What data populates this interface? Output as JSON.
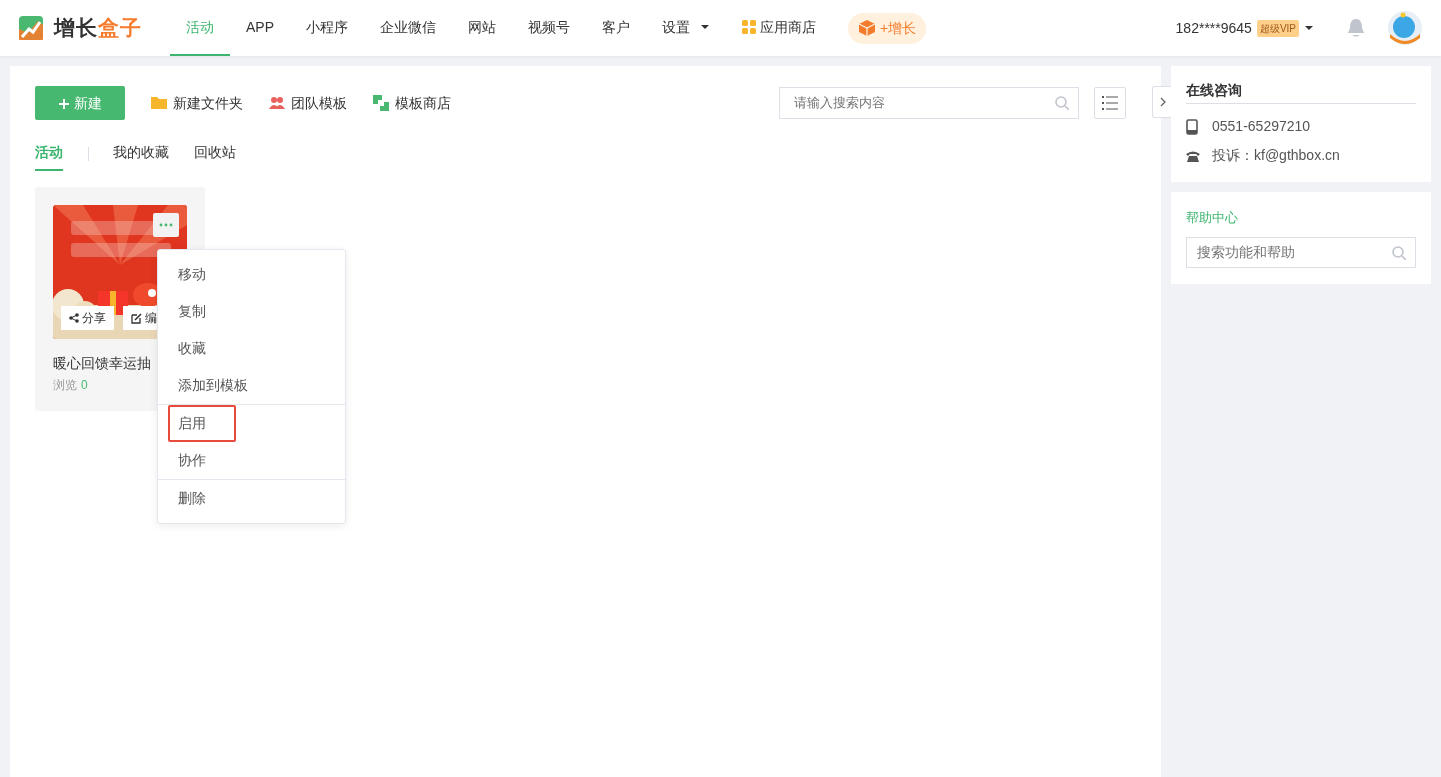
{
  "header": {
    "logo": {
      "part_a": "增长",
      "part_b": "盒子"
    },
    "nav": [
      {
        "label": "活动",
        "selected": true,
        "kind": "link"
      },
      {
        "label": "APP",
        "selected": false,
        "kind": "link"
      },
      {
        "label": "小程序",
        "selected": false,
        "kind": "link"
      },
      {
        "label": "企业微信",
        "selected": false,
        "kind": "link"
      },
      {
        "label": "网站",
        "selected": false,
        "kind": "link"
      },
      {
        "label": "视频号",
        "selected": false,
        "kind": "link"
      },
      {
        "label": "客户",
        "selected": false,
        "kind": "link"
      },
      {
        "label": "设置",
        "selected": false,
        "kind": "dropdown"
      },
      {
        "label": "应用商店",
        "selected": false,
        "kind": "store"
      }
    ],
    "growth_button": "+增长",
    "user": {
      "phone": "182****9645",
      "badge": "超级VIP"
    }
  },
  "toolbar": {
    "new_button": "新建",
    "actions": [
      {
        "label": "新建文件夹",
        "kind": "folder"
      },
      {
        "label": "团队模板",
        "kind": "team"
      },
      {
        "label": "模板商店",
        "kind": "store"
      }
    ],
    "search": {
      "placeholder": "请输入搜索内容"
    }
  },
  "tabs": [
    {
      "label": "活动",
      "selected": true
    },
    {
      "label": "我的收藏",
      "selected": false
    },
    {
      "label": "回收站",
      "selected": false
    }
  ],
  "cards": [
    {
      "kind": "picture",
      "share": "分享",
      "edit": "编",
      "title": "暖心回馈幸运抽",
      "views_label": "浏览",
      "views": "0"
    }
  ],
  "menu": {
    "groups": [
      [
        {
          "label": "移动",
          "highlighted": false
        },
        {
          "label": "复制",
          "highlighted": false
        },
        {
          "label": "收藏",
          "highlighted": false
        },
        {
          "label": "添加到模板",
          "highlighted": false
        }
      ],
      [
        {
          "label": "启用",
          "highlighted": true
        },
        {
          "label": "协作",
          "highlighted": false
        }
      ],
      [
        {
          "label": "删除",
          "highlighted": false
        }
      ]
    ]
  },
  "sidebar": {
    "contact": {
      "title": "在线咨询",
      "phone": "0551-65297210",
      "email": "投诉：kf@gthbox.cn"
    },
    "help": {
      "title": "帮助中心",
      "placeholder": "搜索功能和帮助"
    }
  }
}
